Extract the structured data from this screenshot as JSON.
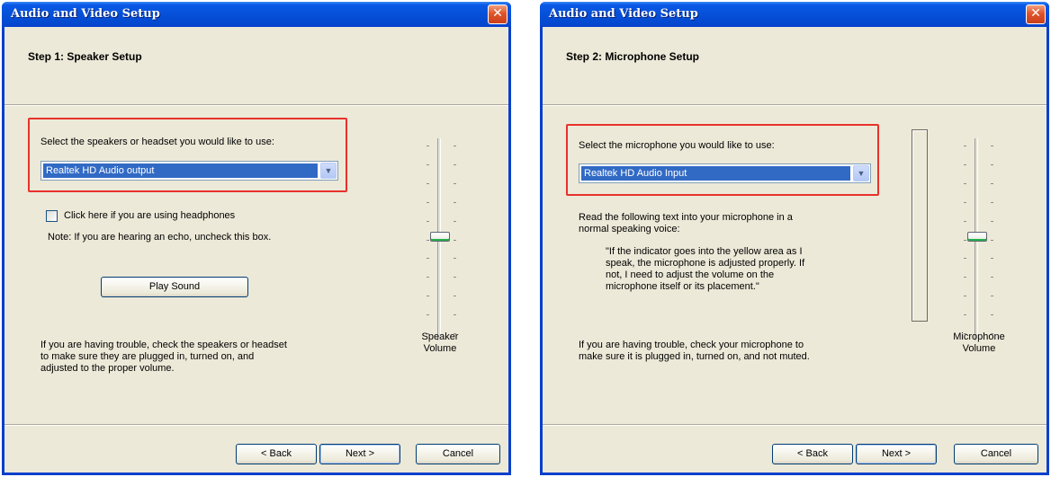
{
  "speaker_window": {
    "title": "Audio and Video Setup",
    "close_glyph": "✕",
    "step_title": "Step 1: Speaker Setup",
    "select_prompt": "Select the speakers or headset you would like to use:",
    "selected_device": "Realtek HD Audio output",
    "combo_arrow": "▼",
    "headphones_checkbox_label": "Click here if you are using headphones",
    "headphones_checked": false,
    "echo_note": "Note: If you are hearing an echo, uncheck this box.",
    "play_sound_label": "Play Sound",
    "volume_label": "Speaker\nVolume",
    "volume_level": 0.5,
    "trouble_text": "If you are having trouble, check the speakers or headset\nto make sure they are plugged in, turned on, and\nadjusted to the proper volume.",
    "buttons": {
      "back": "< Back",
      "next": "Next >",
      "cancel": "Cancel"
    }
  },
  "microphone_window": {
    "title": "Audio and Video Setup",
    "close_glyph": "✕",
    "step_title": "Step 2: Microphone Setup",
    "select_prompt": "Select the microphone you would like to use:",
    "selected_device": "Realtek HD Audio Input",
    "combo_arrow": "▼",
    "instruction": "Read the following text into your microphone in a\nnormal speaking voice:",
    "quote": "\"If the indicator goes into the yellow area as I\nspeak, the microphone is adjusted properly.  If\nnot, I need to adjust the volume on the\nmicrophone itself or its placement.\"",
    "level_meter_value": 0,
    "volume_label": "Microphone\nVolume",
    "volume_level": 0.5,
    "trouble_text": "If you are having trouble, check your microphone to\nmake sure it is plugged in, turned on, and not muted.",
    "buttons": {
      "back": "< Back",
      "next": "Next >",
      "cancel": "Cancel"
    }
  },
  "colors": {
    "titlebar_blue": "#0650d8",
    "dialog_face": "#ece9d8",
    "highlight_box": "#e8312b",
    "selection_blue": "#316ac5"
  }
}
